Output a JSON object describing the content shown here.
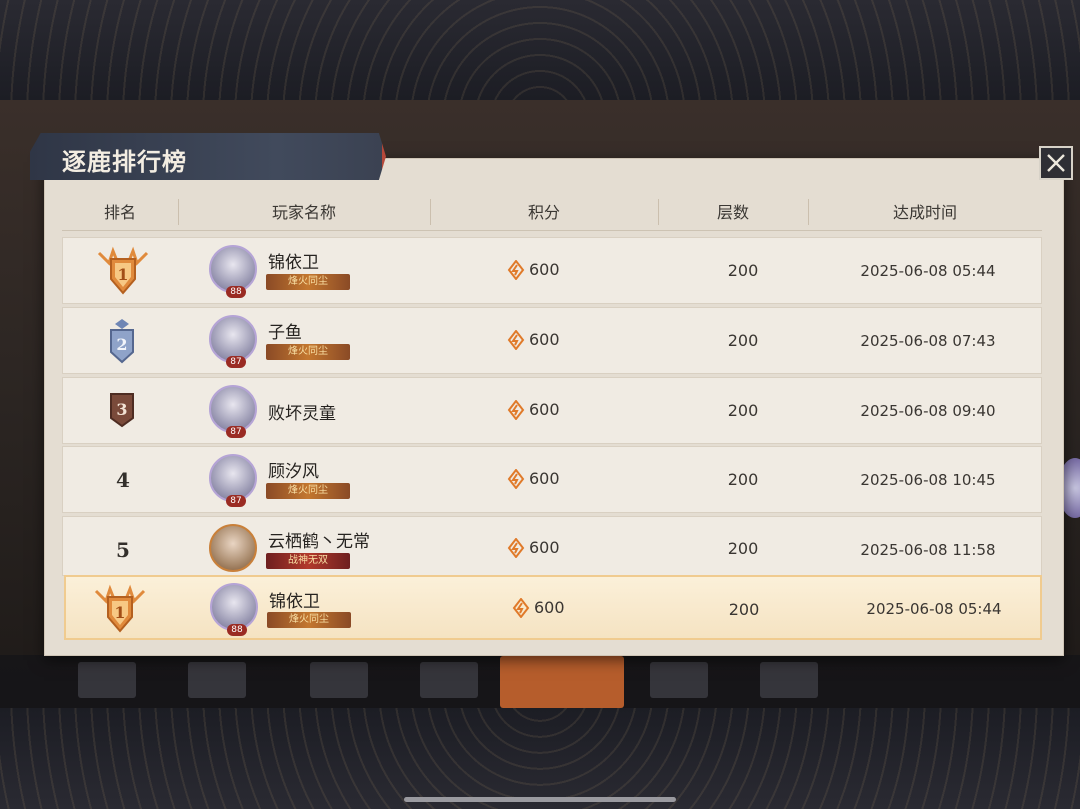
{
  "panel": {
    "title": "逐鹿排行榜",
    "columns": [
      "排名",
      "玩家名称",
      "积分",
      "层数",
      "达成时间"
    ]
  },
  "rows": [
    {
      "rank": "1",
      "name": "锦依卫",
      "level": "88",
      "title_badge": "烽火同尘",
      "score": "600",
      "floors": "200",
      "time": "2025-06-08 05:44"
    },
    {
      "rank": "2",
      "name": "子鱼",
      "level": "87",
      "title_badge": "烽火同尘",
      "score": "600",
      "floors": "200",
      "time": "2025-06-08 07:43"
    },
    {
      "rank": "3",
      "name": "败坏灵童",
      "level": "87",
      "title_badge": "",
      "score": "600",
      "floors": "200",
      "time": "2025-06-08 09:40"
    },
    {
      "rank": "4",
      "name": "顾汐风",
      "level": "87",
      "title_badge": "烽火同尘",
      "score": "600",
      "floors": "200",
      "time": "2025-06-08 10:45"
    },
    {
      "rank": "5",
      "name": "云栖鹤丶无常",
      "level": "",
      "title_badge": "战神无双",
      "score": "600",
      "floors": "200",
      "time": "2025-06-08 11:58"
    }
  ],
  "my_rank": {
    "rank": "1",
    "name": "锦依卫",
    "level": "88",
    "title_badge": "烽火同尘",
    "score": "600",
    "floors": "200",
    "time": "2025-06-08 05:44"
  },
  "colors": {
    "gold_badge": "#e08a3c",
    "silver_badge": "#6f86b5",
    "bronze_badge": "#7a4a3a",
    "highlight_row": "#f7e6c6"
  }
}
